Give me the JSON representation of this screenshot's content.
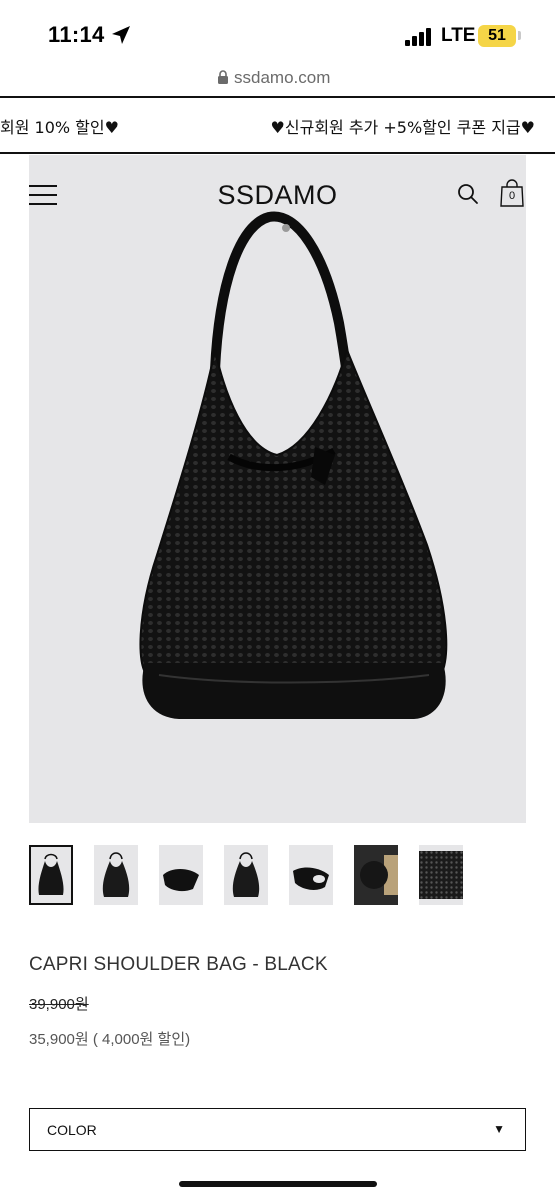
{
  "status_bar": {
    "time": "11:14",
    "network": "LTE",
    "battery": "51",
    "battery_color": "#f5d547"
  },
  "browser": {
    "url": "ssdamo.com",
    "lock_icon": "lock-icon"
  },
  "promo": {
    "left_text": "회원 10% 할인♥",
    "right_text": "♥신규회원 추가 +5%할인 쿠폰 지급♥"
  },
  "header": {
    "brand": "SSDAMO",
    "menu_icon": "hamburger-menu-icon",
    "search_icon": "search-icon",
    "cart_icon": "shopping-bag-icon",
    "cart_count": "0"
  },
  "product": {
    "name": "CAPRI SHOULDER BAG - BLACK",
    "original_price": "39,900원",
    "sale_price": "35,900원 ( 4,000원 할인)",
    "thumbnail_count": 7,
    "selected_thumbnail": 0
  },
  "options": {
    "color_label": "COLOR",
    "caret": "▼"
  }
}
